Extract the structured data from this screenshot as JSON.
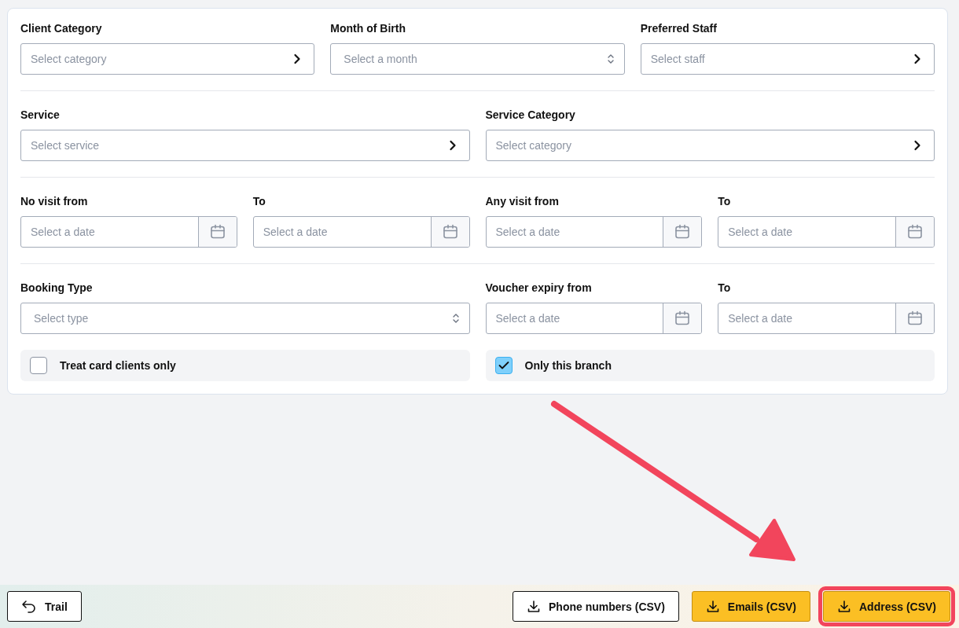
{
  "sections": [
    {
      "fields": [
        {
          "kind": "picker",
          "label": "Client Category",
          "placeholder": "Select category"
        },
        {
          "kind": "select",
          "label": "Month of Birth",
          "placeholder": "Select a month"
        },
        {
          "kind": "picker",
          "label": "Preferred Staff",
          "placeholder": "Select staff"
        }
      ]
    },
    {
      "fields": [
        {
          "kind": "picker",
          "label": "Service",
          "placeholder": "Select service"
        },
        {
          "kind": "picker",
          "label": "Service Category",
          "placeholder": "Select category"
        }
      ]
    },
    {
      "fields": [
        {
          "kind": "date",
          "label": "No visit from",
          "placeholder": "Select a date"
        },
        {
          "kind": "date",
          "label": "To",
          "placeholder": "Select a date"
        },
        {
          "kind": "date",
          "label": "Any visit from",
          "placeholder": "Select a date"
        },
        {
          "kind": "date",
          "label": "To",
          "placeholder": "Select a date"
        }
      ]
    },
    {
      "fields": [
        {
          "kind": "select",
          "label": "Booking Type",
          "placeholder": "Select type"
        },
        {
          "kind": "date",
          "label": "Voucher expiry from",
          "placeholder": "Select a date"
        },
        {
          "kind": "date",
          "label": "To",
          "placeholder": "Select a date"
        }
      ]
    }
  ],
  "checkboxes": [
    {
      "label": "Treat card clients only",
      "checked": false
    },
    {
      "label": "Only this branch",
      "checked": true
    }
  ],
  "footer": {
    "left": [
      {
        "label": "Trail",
        "kind": "outline",
        "highlighted": false
      }
    ],
    "right": [
      {
        "label": "Phone numbers (CSV)",
        "kind": "outline",
        "highlighted": false
      },
      {
        "label": "Emails (CSV)",
        "kind": "primary",
        "highlighted": false
      },
      {
        "label": "Address (CSV)",
        "kind": "primary",
        "highlighted": true
      }
    ]
  }
}
